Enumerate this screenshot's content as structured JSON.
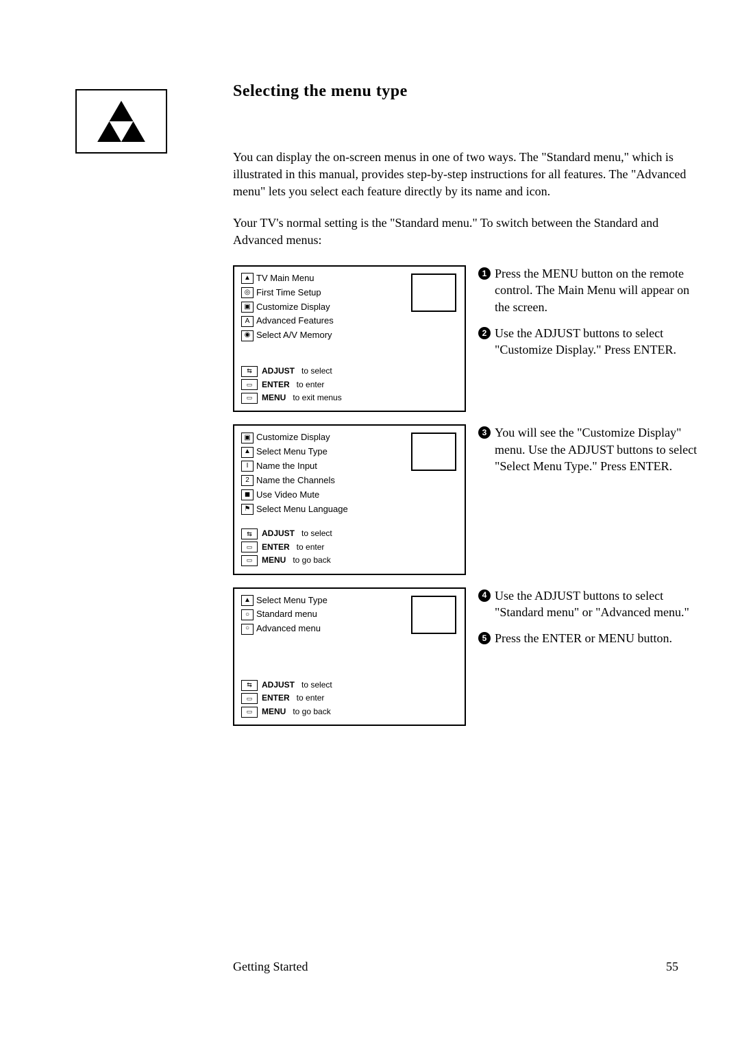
{
  "title": "Selecting the menu type",
  "intro": "You can display the on-screen menus in one of two ways. The \"Standard menu,\" which is illustrated in this manual, provides step-by-step instructions for all features. The \"Advanced menu\" lets you select each feature directly by its name and icon.",
  "sub": "Your TV's normal setting is the \"Standard menu.\" To switch between the Standard and Advanced menus:",
  "screens": {
    "s1": {
      "items": [
        "TV Main Menu",
        "First Time Setup",
        "Customize Display",
        "Advanced Features",
        "Select A/V Memory"
      ],
      "hints": [
        {
          "label": "ADJUST",
          "text": "to select"
        },
        {
          "label": "ENTER",
          "text": "to enter"
        },
        {
          "label": "MENU",
          "text": "to exit menus"
        }
      ]
    },
    "s2": {
      "items": [
        "Customize Display",
        "Select Menu Type",
        "Name the Input",
        "Name the Channels",
        "Use Video Mute",
        "Select Menu Language"
      ],
      "hints": [
        {
          "label": "ADJUST",
          "text": "to select"
        },
        {
          "label": "ENTER",
          "text": "to enter"
        },
        {
          "label": "MENU",
          "text": "to go back"
        }
      ]
    },
    "s3": {
      "items": [
        "Select Menu Type",
        "Standard menu",
        "Advanced menu"
      ],
      "hints": [
        {
          "label": "ADJUST",
          "text": "to select"
        },
        {
          "label": "ENTER",
          "text": "to enter"
        },
        {
          "label": "MENU",
          "text": "to go back"
        }
      ]
    }
  },
  "steps": {
    "1": "Press the MENU button on the remote control. The Main Menu will appear on the screen.",
    "2": "Use the ADJUST buttons to select \"Customize Display.\" Press ENTER.",
    "3": "You will see the \"Customize Display\" menu. Use the ADJUST buttons to select \"Select Menu Type.\" Press ENTER.",
    "4": "Use the ADJUST buttons to select \"Standard menu\" or \"Advanced menu.\"",
    "5": "Press the ENTER or MENU button."
  },
  "footer": {
    "section": "Getting Started",
    "page": "55"
  }
}
